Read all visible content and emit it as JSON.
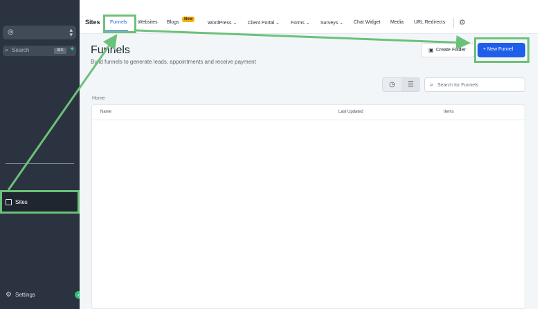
{
  "sidebar": {
    "search_label": "Search",
    "search_shortcut": "⌘K",
    "nav": [
      {
        "label": "Sites",
        "icon": "sites-icon"
      }
    ],
    "settings_label": "Settings"
  },
  "topbar": {
    "section": "Sites",
    "tabs": [
      {
        "label": "Funnels",
        "active": true
      },
      {
        "label": "Websites"
      },
      {
        "label": "Blogs",
        "badge": "New"
      },
      {
        "label": "WordPress",
        "dropdown": true
      },
      {
        "label": "Client Portal",
        "dropdown": true
      },
      {
        "label": "Forms",
        "dropdown": true
      },
      {
        "label": "Surveys",
        "dropdown": true
      },
      {
        "label": "Chat Widget"
      },
      {
        "label": "Media"
      },
      {
        "label": "URL Redirects"
      }
    ]
  },
  "page": {
    "title": "Funnels",
    "subtitle": "Build funnels to generate leads, appointments and receive payment",
    "create_folder_label": "Create Folder",
    "new_funnel_label": "+ New Funnel",
    "search_placeholder": "Search for Funnels",
    "breadcrumb": "Home",
    "columns": [
      "Name",
      "Last Updated",
      "Items"
    ]
  },
  "colors": {
    "accent": "#1f5eea",
    "sidebar_bg": "#2b3340",
    "annotation": "#6cc17a",
    "badge": "#f5b014"
  }
}
